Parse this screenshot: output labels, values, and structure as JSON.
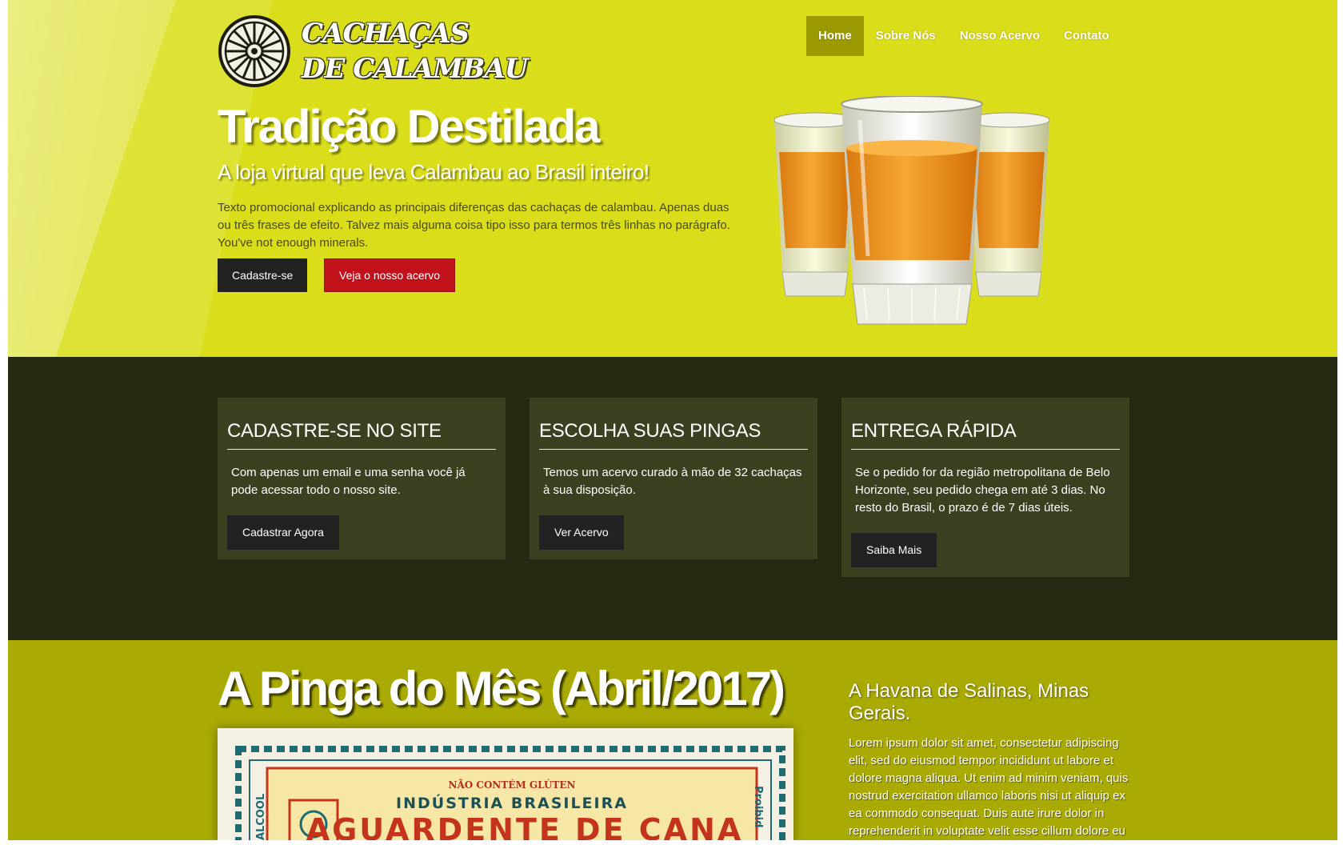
{
  "logo": {
    "line1": "Cachaças",
    "line2": "de Calambau"
  },
  "nav": {
    "items": [
      {
        "label": "Home",
        "active": true
      },
      {
        "label": "Sobre Nós",
        "active": false
      },
      {
        "label": "Nosso Acervo",
        "active": false
      },
      {
        "label": "Contato",
        "active": false
      }
    ]
  },
  "hero": {
    "title": "Tradição Destilada",
    "subtitle": "A loja virtual que leva Calambau ao Brasil inteiro!",
    "text": "Texto promocional explicando as principais diferenças das cachaças de calambau. Apenas duas ou três frases de efeito. Talvez mais alguma coisa tipo isso para termos três linhas no parágrafo. You've not enough minerals.",
    "primary_button": "Cadastre-se",
    "secondary_button": "Veja o nosso acervo"
  },
  "features": [
    {
      "title": "CADASTRE-SE NO SITE",
      "text": "Com apenas um email e uma senha você já pode acessar todo o nosso site.",
      "button": "Cadastrar Agora"
    },
    {
      "title": "ESCOLHA SUAS PINGAS",
      "text": "Temos um acervo curado à mão de 32 cachaças à sua disposição.",
      "button": "Ver Acervo"
    },
    {
      "title": "ENTREGA RÁPIDA",
      "text": "Se o pedido for da região metropolitana de Belo Horizonte, seu pedido chega em até 3 dias. No resto do Brasil, o prazo é de 7 dias úteis.",
      "button": "Saiba Mais"
    }
  ],
  "pinga": {
    "title": "A Pinga do Mês (Abril/2017)",
    "side_title": "A Havana de Salinas, Minas Gerais.",
    "side_text": "Lorem ipsum dolor sit amet, consectetur adipiscing elit, sed do eiusmod tempor incididunt ut labore et dolore magna aliqua. Ut enim ad minim veniam, quis nostrud exercitation ullamco laboris nisi ut aliquip ex ea commodo consequat. Duis aute irure dolor in reprehenderit in voluptate velit esse cillum dolore eu",
    "label": {
      "top": "NÃO CONTÉM GLÚTEN",
      "mid": "INDÚSTRIA BRASILEIRA",
      "main": "AGUARDENTE DE CANA",
      "left": "ALCOOL",
      "right": "Proibid"
    }
  },
  "colors": {
    "hero_bg": "#dade1a",
    "nav_active": "#9a9a00",
    "features_bg": "#252a12",
    "card_bg": "#3b4020",
    "pinga_bg": "#aaaa05",
    "button_dark": "#222222",
    "button_red": "#c1121c"
  },
  "icons": [
    "wagon-wheel-icon",
    "cachaca-glasses-image",
    "cachaca-label-image"
  ]
}
